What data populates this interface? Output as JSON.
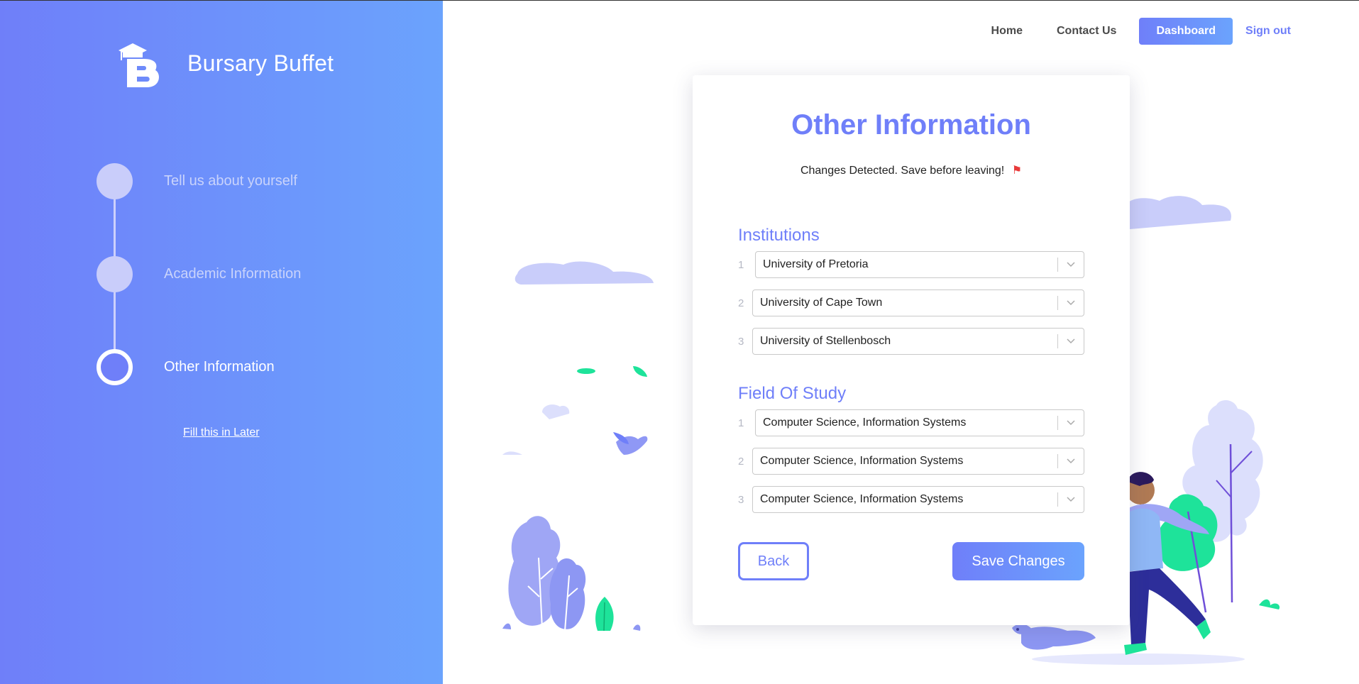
{
  "brand": {
    "name": "Bursary Buffet"
  },
  "steps": [
    {
      "label": "Tell us about yourself",
      "active": false
    },
    {
      "label": "Academic Information",
      "active": false
    },
    {
      "label": "Other Information",
      "active": true
    }
  ],
  "later_link": "Fill this in Later",
  "nav": {
    "home": "Home",
    "contact": "Contact Us",
    "dashboard": "Dashboard",
    "signout": "Sign out"
  },
  "form": {
    "title": "Other Information",
    "changes_note": "Changes Detected. Save before leaving!",
    "flag_icon": "red-flag-icon",
    "institutions": {
      "title": "Institutions",
      "items": [
        {
          "num": "1",
          "value": "University of Pretoria"
        },
        {
          "num": "2",
          "value": "University of Cape Town"
        },
        {
          "num": "3",
          "value": "University of Stellenbosch"
        }
      ]
    },
    "fields": {
      "title": "Field Of Study",
      "items": [
        {
          "num": "1",
          "value": "Computer Science, Information Systems"
        },
        {
          "num": "2",
          "value": "Computer Science, Information Systems"
        },
        {
          "num": "3",
          "value": "Computer Science, Information Systems"
        }
      ]
    },
    "back_label": "Back",
    "save_label": "Save Changes"
  },
  "colors": {
    "accent": "#6f7ff9",
    "accent_light": "#6ba3fd",
    "flag": "#e83b3b",
    "leaf_green": "#1ee39a"
  }
}
